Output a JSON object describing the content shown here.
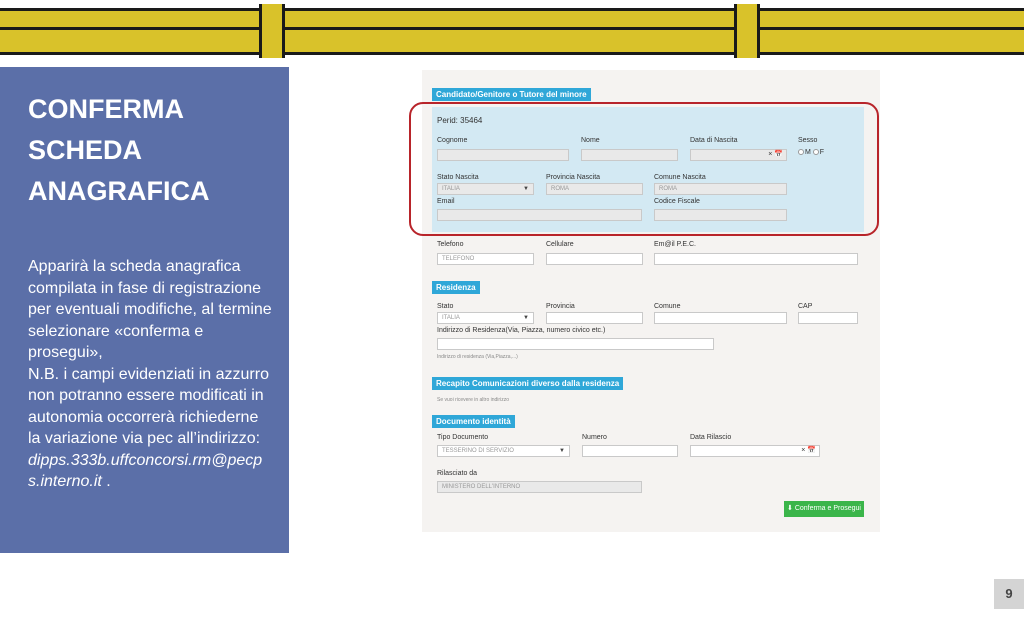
{
  "slide": {
    "title": "CONFERMA SCHEDA ANAGRAFICA",
    "description": "Apparirà la scheda anagrafica compilata in fase di registrazione per eventuali modifiche, al termine selezionare «conferma e prosegui»,",
    "note": "N.B. i campi evidenziati in azzurro non potranno essere modificati in autonomia occorrerà richiederne la variazione via pec all’indirizzo:",
    "email": "dipps.333b.uffconcorsi.rm@pecps.interno.it",
    "email_suffix": " .",
    "page_number": "9"
  },
  "form": {
    "section_candidate": "Candidato/Genitore o Tutore del minore",
    "perid": "Perid: 35464",
    "labels": {
      "cognome": "Cognome",
      "nome": "Nome",
      "data_nascita": "Data di Nascita",
      "sesso": "Sesso",
      "stato_nascita": "Stato Nascita",
      "provincia_nascita": "Provincia Nascita",
      "comune_nascita": "Comune Nascita",
      "email": "Email",
      "codice_fiscale": "Codice Fiscale",
      "telefono": "Telefono",
      "cellulare": "Cellulare",
      "pec": "Em@il P.E.C.",
      "stato": "Stato",
      "provincia": "Provincia",
      "comune": "Comune",
      "cap": "CAP",
      "indirizzo": "Indirizzo di Residenza(Via, Piazza, numero civico etc.)",
      "tipo_documento": "Tipo Documento",
      "numero": "Numero",
      "data_rilascio": "Data Rilascio",
      "rilasciato_da": "Rilasciato da"
    },
    "values": {
      "stato_nascita": "ITALIA",
      "provincia_nascita": "ROMA",
      "comune_nascita": "ROMA",
      "stato": "ITALIA",
      "tipo_documento": "TESSERINO DI SERVIZIO",
      "rilasciato_da": "MINISTERO DELL'INTERNO"
    },
    "sex_options": [
      "M",
      "F"
    ],
    "placeholders": {
      "telefono": "TELEFONO",
      "indirizzo": "Indirizzo di residenza (Via,Piazza,...)"
    },
    "section_residenza": "Residenza",
    "section_recapito": "Recapito Comunicazioni diverso dalla residenza",
    "recapito_hint": "Se vuoi ricevere in altro indirizzo",
    "section_documento": "Documento identità",
    "clear_glyph": "×",
    "calendar_glyph": "📅",
    "submit_label": "⬇ Conferma e Prosegui"
  },
  "colors": {
    "left_panel": "#5b6fa8",
    "section_header": "#2fa7d8",
    "readonly_area": "#d3e9f3",
    "highlight_ring": "#b8242a",
    "submit_button": "#3bb54a",
    "header_yellow": "#d9c22a"
  }
}
